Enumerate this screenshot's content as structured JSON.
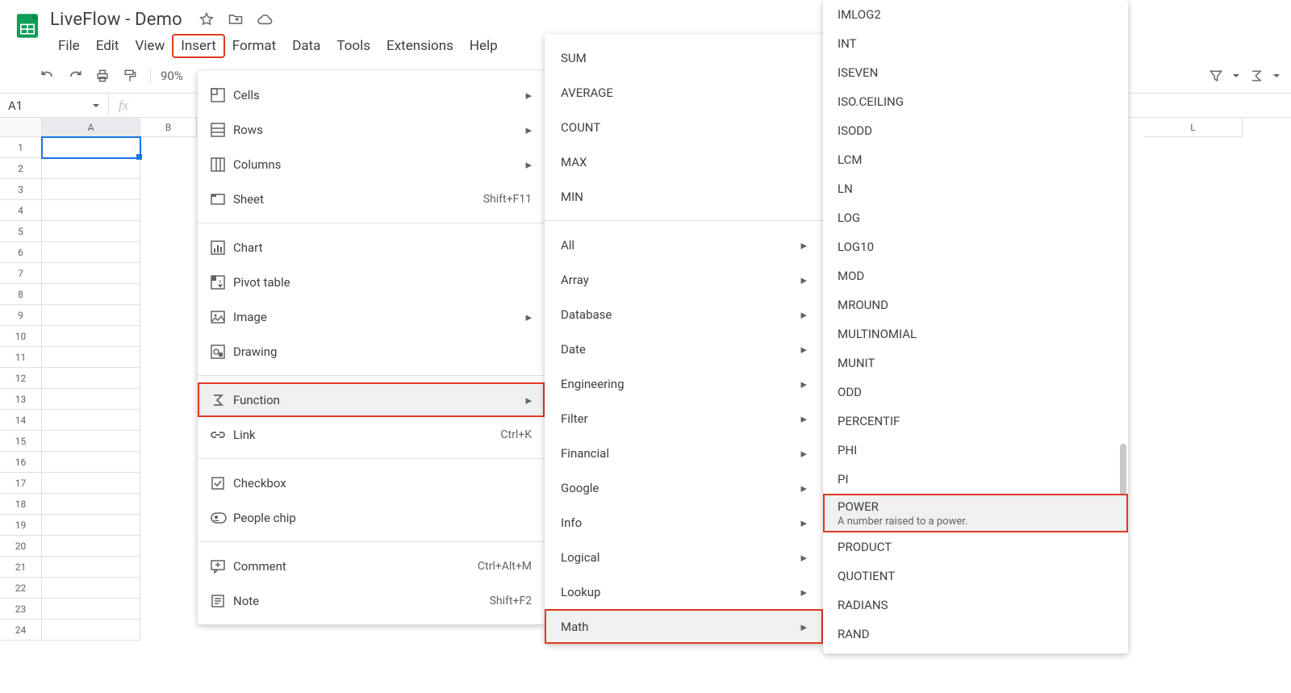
{
  "doc_title": "LiveFlow - Demo",
  "menubar": [
    "File",
    "Edit",
    "View",
    "Insert",
    "Format",
    "Data",
    "Tools",
    "Extensions",
    "Help"
  ],
  "zoom": "90%",
  "namebox": "A1",
  "col_letters": [
    "A",
    "B",
    "L"
  ],
  "insert_menu": {
    "cells": "Cells",
    "rows": "Rows",
    "columns": "Columns",
    "sheet": "Sheet",
    "sheet_k": "Shift+F11",
    "chart": "Chart",
    "pivot": "Pivot table",
    "image": "Image",
    "drawing": "Drawing",
    "function": "Function",
    "link": "Link",
    "link_k": "Ctrl+K",
    "checkbox": "Checkbox",
    "people": "People chip",
    "comment": "Comment",
    "comment_k": "Ctrl+Alt+M",
    "note": "Note",
    "note_k": "Shift+F2"
  },
  "fn_menu": {
    "sum": "SUM",
    "avg": "AVERAGE",
    "count": "COUNT",
    "max": "MAX",
    "min": "MIN",
    "all": "All",
    "array": "Array",
    "database": "Database",
    "date": "Date",
    "engineering": "Engineering",
    "filter": "Filter",
    "financial": "Financial",
    "google": "Google",
    "info": "Info",
    "logical": "Logical",
    "lookup": "Lookup",
    "math": "Math"
  },
  "math_menu": [
    "IMLOG2",
    "INT",
    "ISEVEN",
    "ISO.CEILING",
    "ISODD",
    "LCM",
    "LN",
    "LOG",
    "LOG10",
    "MOD",
    "MROUND",
    "MULTINOMIAL",
    "MUNIT",
    "ODD",
    "PERCENTIF",
    "PHI",
    "PI",
    "POWER",
    "PRODUCT",
    "QUOTIENT",
    "RADIANS",
    "RAND"
  ],
  "power_desc": "A number raised to a power."
}
